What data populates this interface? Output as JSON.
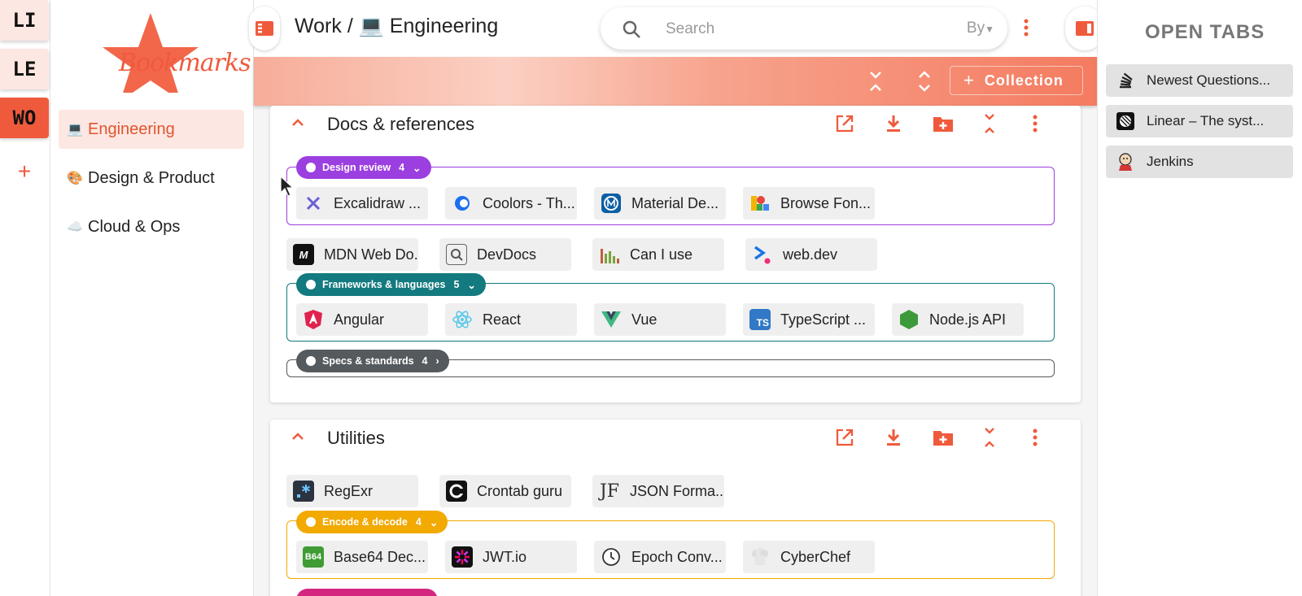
{
  "workspaces": [
    {
      "label": "LI",
      "active": false
    },
    {
      "label": "LE",
      "active": false
    },
    {
      "label": "WO",
      "active": true
    }
  ],
  "workspace_add": "+",
  "logo_text": "Bookmarks",
  "nav": [
    {
      "emoji": "💻",
      "label": "Engineering",
      "active": true
    },
    {
      "emoji": "🎨",
      "label": "Design & Product",
      "active": false
    },
    {
      "emoji": "☁️",
      "label": "Cloud & Ops",
      "active": false
    }
  ],
  "header": {
    "breadcrumb": "Work / 💻 Engineering",
    "search_placeholder": "Search",
    "search_by": "By"
  },
  "toolbar": {
    "collection_label": "Collection"
  },
  "colors": {
    "accent": "#f05a3c",
    "purple": "#9c3fe0",
    "teal": "#137a7f",
    "gray": "#555a5e",
    "amber": "#f2a900",
    "magenta": "#d4267f"
  },
  "cards": [
    {
      "title": "Docs & references",
      "groups": [
        {
          "name": "Design review",
          "count": "4",
          "bookmarks": [
            "Excalidraw ...",
            "Coolors - Th...",
            "Material De...",
            "Browse Fon..."
          ]
        },
        {
          "name": "Frameworks & languages",
          "count": "5",
          "bookmarks": [
            "Angular",
            "React",
            "Vue",
            "TypeScript ...",
            "Node.js API"
          ]
        },
        {
          "name": "Specs & standards",
          "count": "4"
        }
      ],
      "bookmarks": [
        "MDN Web Do...",
        "DevDocs",
        "Can I use",
        "web.dev"
      ]
    },
    {
      "title": "Utilities",
      "bookmarks": [
        "RegExr",
        "Crontab guru",
        "JSON Forma..."
      ],
      "groups": [
        {
          "name": "Encode & decode",
          "count": "4",
          "bookmarks": [
            "Base64 Dec...",
            "JWT.io",
            "Epoch Conv...",
            "CyberChef"
          ]
        }
      ]
    }
  ],
  "open_tabs": {
    "title": "OPEN TABS",
    "tabs": [
      "Newest Questions...",
      "Linear – The syst...",
      "Jenkins"
    ]
  }
}
